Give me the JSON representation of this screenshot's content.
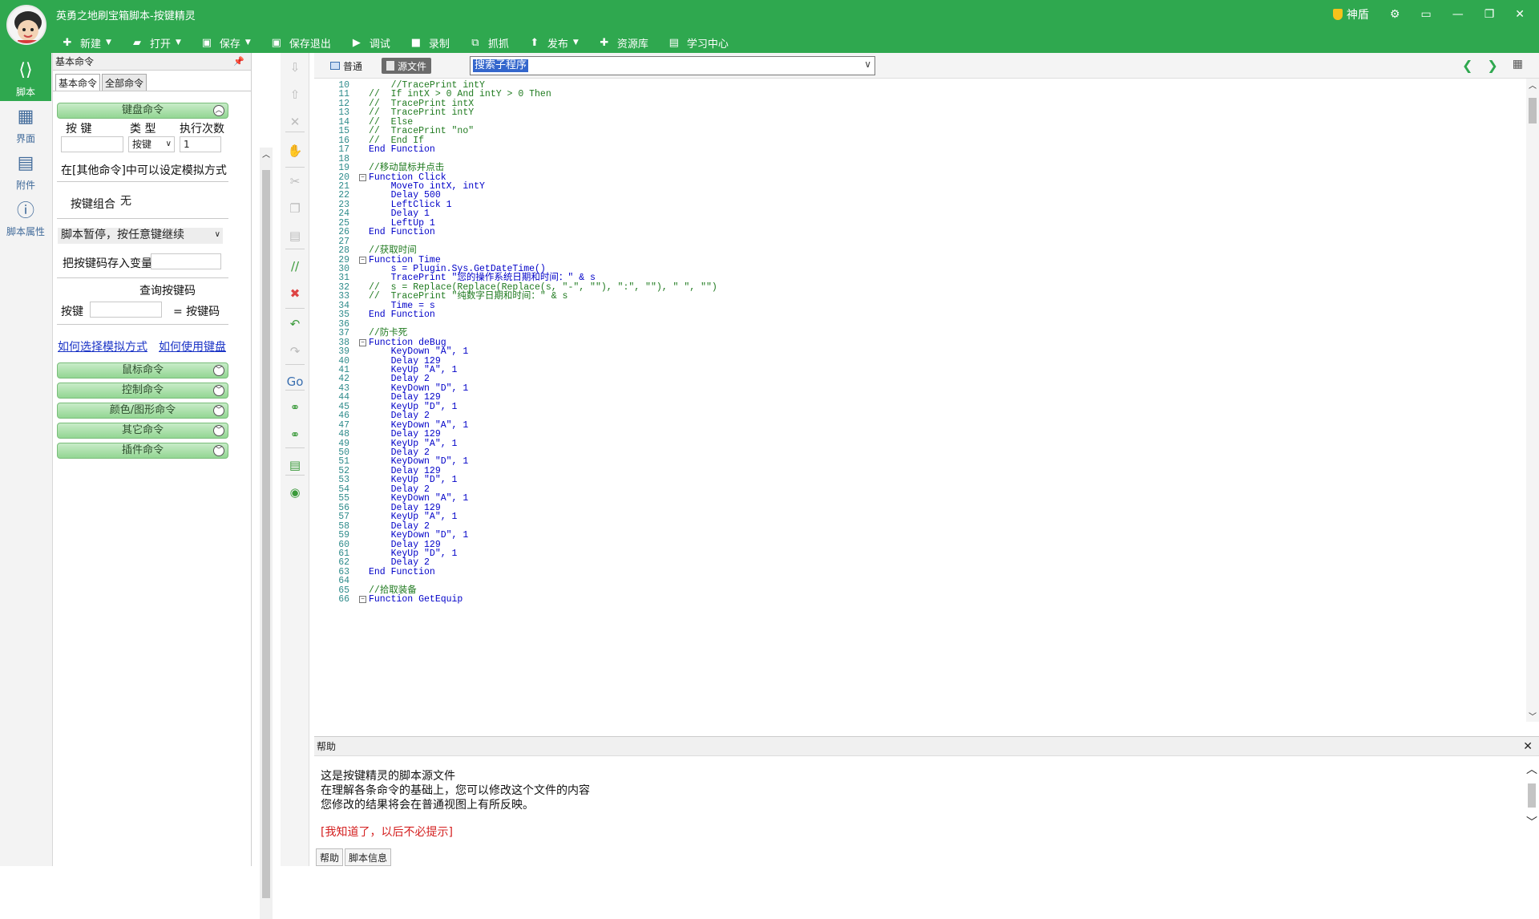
{
  "app": {
    "title": "英勇之地刷宝箱脚本-按键精灵",
    "shield_label": "神盾"
  },
  "toolbar": [
    {
      "label": "新建",
      "icon": "plus-icon",
      "caret": true
    },
    {
      "label": "打开",
      "icon": "folder-icon",
      "caret": true
    },
    {
      "label": "保存",
      "icon": "save-icon",
      "caret": true
    },
    {
      "label": "保存退出",
      "icon": "save-exit-icon",
      "caret": false
    },
    {
      "label": "调试",
      "icon": "play-icon",
      "caret": false
    },
    {
      "label": "录制",
      "icon": "camera-icon",
      "caret": false
    },
    {
      "label": "抓抓",
      "icon": "capture-icon",
      "caret": false
    },
    {
      "label": "发布",
      "icon": "publish-icon",
      "caret": true
    },
    {
      "label": "资源库",
      "icon": "resource-icon",
      "caret": false
    },
    {
      "label": "学习中心",
      "icon": "learn-icon",
      "caret": false
    }
  ],
  "leftnav": [
    {
      "label": "脚本",
      "icon": "script-icon",
      "active": true
    },
    {
      "label": "界面",
      "icon": "ui-icon",
      "active": false
    },
    {
      "label": "附件",
      "icon": "attachment-icon",
      "active": false
    },
    {
      "label": "脚本属性",
      "icon": "info-icon",
      "active": false
    }
  ],
  "panel": {
    "title": "基本命令",
    "tabs": [
      "基本命令",
      "全部命令"
    ],
    "keyboard_section": "键盘命令",
    "col_key": "按 键",
    "col_type": "类 型",
    "col_times": "执行次数",
    "type_value": "按键",
    "times_value": "1",
    "sim_hint": "在[其他命令]中可以设定模拟方式",
    "combo_label": "按键组合",
    "combo_value": "无",
    "pause_option": "脚本暂停，按任意键继续",
    "store_label": "把按键码存入变量",
    "query_label": "查询按键码",
    "key_label": "按键",
    "keycode_label": "= 按键码",
    "link1": "如何选择模拟方式",
    "link2": "如何使用键盘",
    "sections": [
      "鼠标命令",
      "控制命令",
      "颜色/图形命令",
      "其它命令",
      "插件命令"
    ]
  },
  "editor": {
    "view_normal": "普通",
    "view_source": "源文件",
    "search_placeholder": "搜索子程序",
    "lines": [
      {
        "n": "10",
        "t": "    //TracePrint intY",
        "c": "cm"
      },
      {
        "n": "11",
        "t": "//  If intX > 0 And intY > 0 Then",
        "c": "cm"
      },
      {
        "n": "12",
        "t": "//  TracePrint intX",
        "c": "cm"
      },
      {
        "n": "13",
        "t": "//  TracePrint intY",
        "c": "cm"
      },
      {
        "n": "14",
        "t": "//  Else",
        "c": "cm"
      },
      {
        "n": "15",
        "t": "//  TracePrint \"no\"",
        "c": "cm"
      },
      {
        "n": "16",
        "t": "//  End If",
        "c": "cm"
      },
      {
        "n": "17",
        "t": "End Function",
        "c": "kw"
      },
      {
        "n": "18",
        "t": "",
        "c": "kw"
      },
      {
        "n": "19",
        "t": "//移动鼠标并点击",
        "c": "cm"
      },
      {
        "n": "20",
        "t": "Function Click",
        "c": "kw",
        "fold": true
      },
      {
        "n": "21",
        "t": "    MoveTo intX, intY",
        "c": "kw"
      },
      {
        "n": "22",
        "t": "    Delay 500",
        "c": "kw"
      },
      {
        "n": "23",
        "t": "    LeftClick 1",
        "c": "kw"
      },
      {
        "n": "24",
        "t": "    Delay 1",
        "c": "kw"
      },
      {
        "n": "25",
        "t": "    LeftUp 1",
        "c": "kw"
      },
      {
        "n": "26",
        "t": "End Function",
        "c": "kw"
      },
      {
        "n": "27",
        "t": "",
        "c": "kw"
      },
      {
        "n": "28",
        "t": "//获取时间",
        "c": "cm"
      },
      {
        "n": "29",
        "t": "Function Time",
        "c": "kw",
        "fold": true
      },
      {
        "n": "30",
        "t": "    s = Plugin.Sys.GetDateTime()",
        "c": "kw"
      },
      {
        "n": "31",
        "t": "    TracePrint \"您的操作系统日期和时间：\" & s",
        "c": "kw"
      },
      {
        "n": "32",
        "t": "//  s = Replace(Replace(Replace(s, \"-\", \"\"), \":\", \"\"), \" \", \"\")",
        "c": "cm"
      },
      {
        "n": "33",
        "t": "//  TracePrint \"纯数字日期和时间：\" & s",
        "c": "cm"
      },
      {
        "n": "34",
        "t": "    Time = s",
        "c": "kw"
      },
      {
        "n": "35",
        "t": "End Function",
        "c": "kw"
      },
      {
        "n": "36",
        "t": "",
        "c": "kw"
      },
      {
        "n": "37",
        "t": "//防卡死",
        "c": "cm"
      },
      {
        "n": "38",
        "t": "Function deBug",
        "c": "kw",
        "fold": true
      },
      {
        "n": "39",
        "t": "    KeyDown \"A\", 1",
        "c": "kw"
      },
      {
        "n": "40",
        "t": "    Delay 129",
        "c": "kw"
      },
      {
        "n": "41",
        "t": "    KeyUp \"A\", 1",
        "c": "kw"
      },
      {
        "n": "42",
        "t": "    Delay 2",
        "c": "kw"
      },
      {
        "n": "43",
        "t": "    KeyDown \"D\", 1",
        "c": "kw"
      },
      {
        "n": "44",
        "t": "    Delay 129",
        "c": "kw"
      },
      {
        "n": "45",
        "t": "    KeyUp \"D\", 1",
        "c": "kw"
      },
      {
        "n": "46",
        "t": "    Delay 2",
        "c": "kw"
      },
      {
        "n": "47",
        "t": "    KeyDown \"A\", 1",
        "c": "kw"
      },
      {
        "n": "48",
        "t": "    Delay 129",
        "c": "kw"
      },
      {
        "n": "49",
        "t": "    KeyUp \"A\", 1",
        "c": "kw"
      },
      {
        "n": "50",
        "t": "    Delay 2",
        "c": "kw"
      },
      {
        "n": "51",
        "t": "    KeyDown \"D\", 1",
        "c": "kw"
      },
      {
        "n": "52",
        "t": "    Delay 129",
        "c": "kw"
      },
      {
        "n": "53",
        "t": "    KeyUp \"D\", 1",
        "c": "kw"
      },
      {
        "n": "54",
        "t": "    Delay 2",
        "c": "kw"
      },
      {
        "n": "55",
        "t": "    KeyDown \"A\", 1",
        "c": "kw"
      },
      {
        "n": "56",
        "t": "    Delay 129",
        "c": "kw"
      },
      {
        "n": "57",
        "t": "    KeyUp \"A\", 1",
        "c": "kw"
      },
      {
        "n": "58",
        "t": "    Delay 2",
        "c": "kw"
      },
      {
        "n": "59",
        "t": "    KeyDown \"D\", 1",
        "c": "kw"
      },
      {
        "n": "60",
        "t": "    Delay 129",
        "c": "kw"
      },
      {
        "n": "61",
        "t": "    KeyUp \"D\", 1",
        "c": "kw"
      },
      {
        "n": "62",
        "t": "    Delay 2",
        "c": "kw"
      },
      {
        "n": "63",
        "t": "End Function",
        "c": "kw"
      },
      {
        "n": "64",
        "t": "",
        "c": "kw"
      },
      {
        "n": "65",
        "t": "//拾取装备",
        "c": "cm"
      },
      {
        "n": "66",
        "t": "Function GetEquip",
        "c": "kw",
        "fold": true
      }
    ]
  },
  "help": {
    "title": "帮助",
    "line1": "这是按键精灵的脚本源文件",
    "line2": "在理解各条命令的基础上，您可以修改这个文件的内容",
    "line3": "您修改的结果将会在普通视图上有所反映。",
    "dismiss": "[我知道了，以后不必提示]",
    "tab1": "帮助",
    "tab2": "脚本信息"
  },
  "colors": {
    "accent": "#2fa84f",
    "comment": "#1f7a1f",
    "keyword": "#0000c8",
    "line_number": "#2e8b8b"
  }
}
